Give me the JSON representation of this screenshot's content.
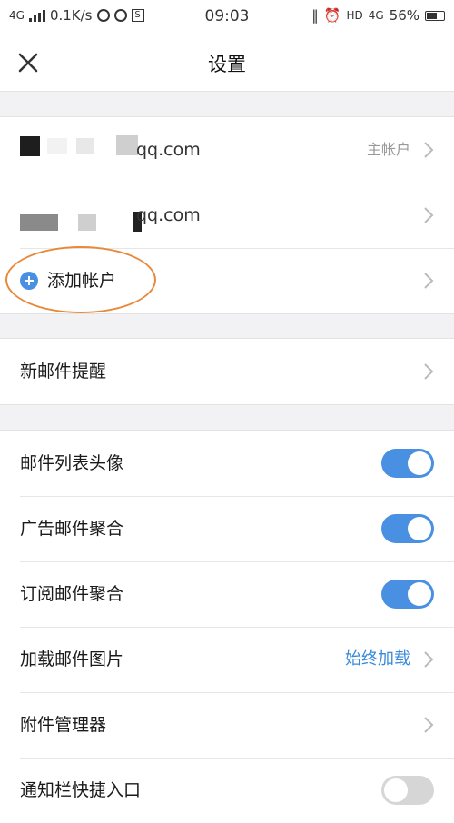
{
  "status_bar": {
    "network_left": "4G",
    "speed": "0.1K/s",
    "time": "09:03",
    "hd": "HD",
    "network_right": "4G",
    "battery": "56%"
  },
  "nav": {
    "title": "设置"
  },
  "accounts": {
    "items": [
      {
        "domain": "qq.com",
        "tag": "主帐户"
      },
      {
        "domain": "qq.com",
        "tag": ""
      }
    ],
    "add_label": "添加帐户"
  },
  "notify": {
    "label": "新邮件提醒"
  },
  "settings": {
    "avatar": {
      "label": "邮件列表头像",
      "on": true
    },
    "ads": {
      "label": "广告邮件聚合",
      "on": true
    },
    "subscribe": {
      "label": "订阅邮件聚合",
      "on": true
    },
    "images": {
      "label": "加载邮件图片",
      "value": "始终加载"
    },
    "attachments": {
      "label": "附件管理器"
    },
    "shortcut": {
      "label": "通知栏快捷入口",
      "on": false
    }
  },
  "colors": {
    "accent": "#4a90e2",
    "highlight": "#e8893a"
  }
}
